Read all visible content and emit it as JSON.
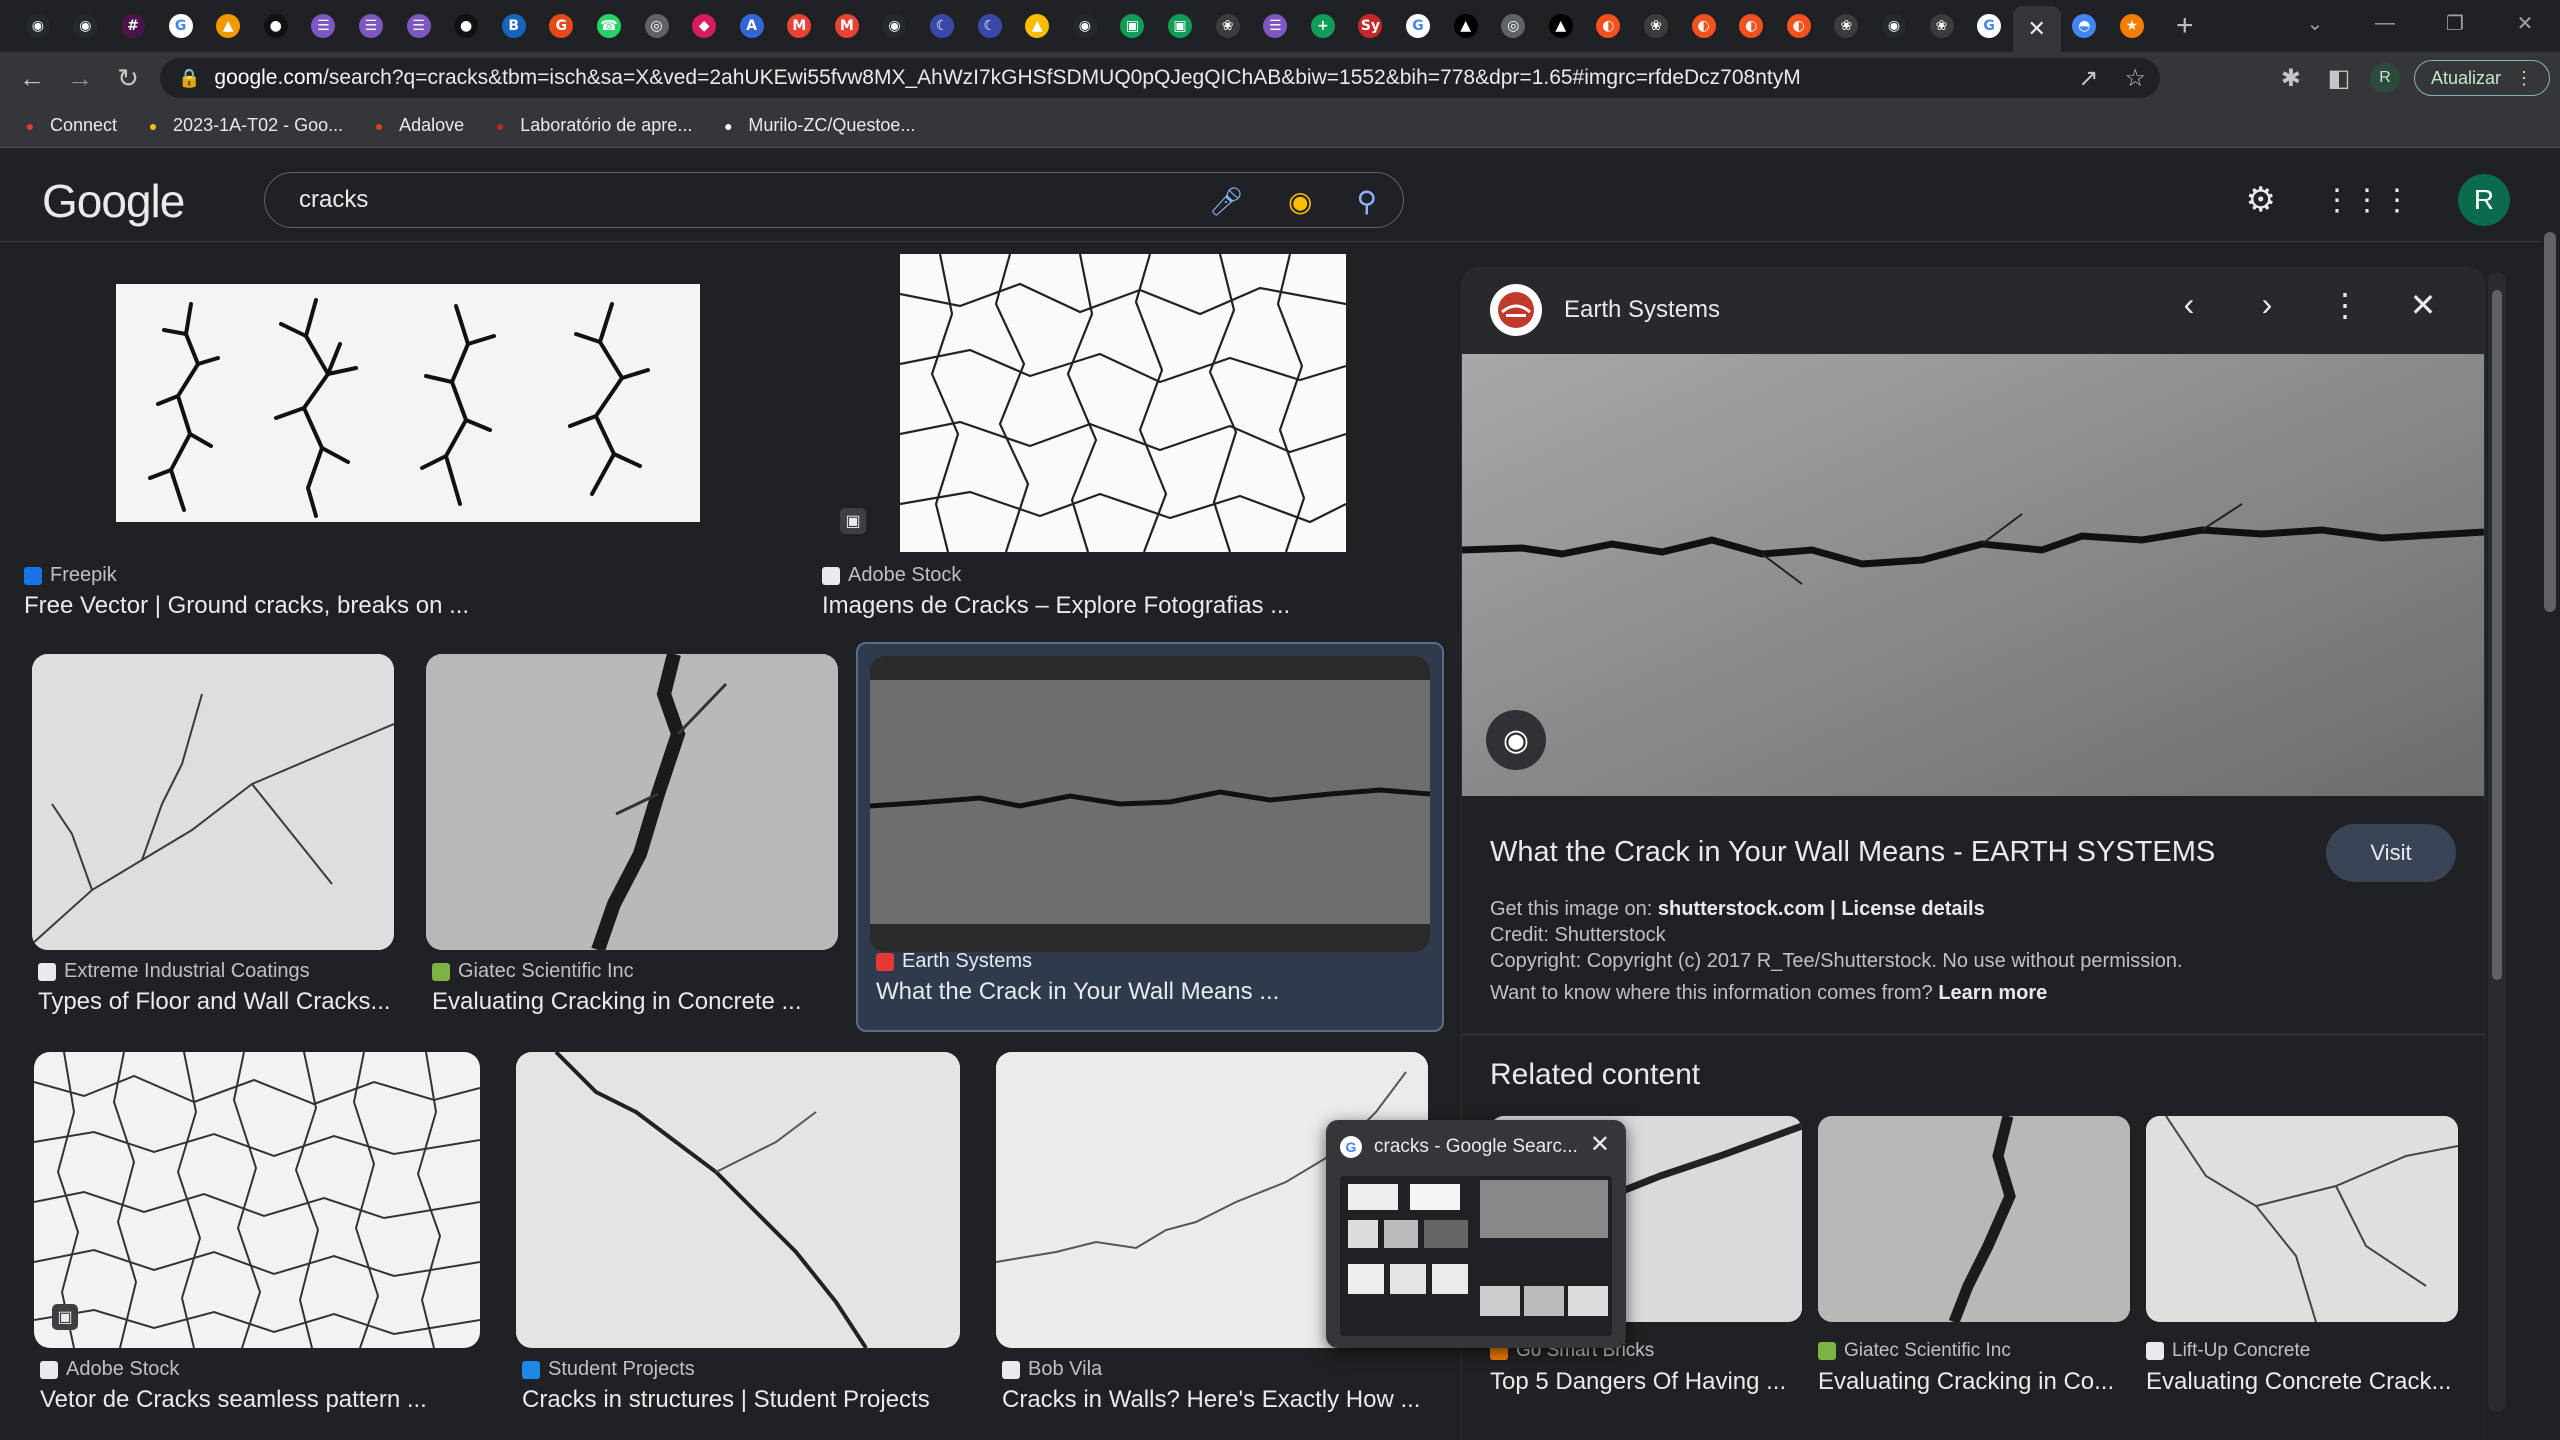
{
  "browser": {
    "tabs": [
      {
        "icon": "github-icon",
        "glyph": "◉",
        "bg": "#24292f"
      },
      {
        "icon": "github-icon",
        "glyph": "◉",
        "bg": "#24292f"
      },
      {
        "icon": "slack-icon",
        "glyph": "#",
        "bg": "#4a154b"
      },
      {
        "icon": "google-icon",
        "glyph": "G",
        "bg": "#ffffff"
      },
      {
        "icon": "orange-icon",
        "glyph": "▲",
        "bg": "#f29900"
      },
      {
        "icon": "notion-icon",
        "glyph": "●",
        "bg": "#111111"
      },
      {
        "icon": "list-icon",
        "glyph": "☰",
        "bg": "#7e57c2"
      },
      {
        "icon": "list-icon",
        "glyph": "☰",
        "bg": "#7e57c2"
      },
      {
        "icon": "list-icon",
        "glyph": "☰",
        "bg": "#7e57c2"
      },
      {
        "icon": "notion-icon",
        "glyph": "●",
        "bg": "#111111"
      },
      {
        "icon": "b-icon",
        "glyph": "B",
        "bg": "#1565c0"
      },
      {
        "icon": "g-icon",
        "glyph": "G",
        "bg": "#e64a19"
      },
      {
        "icon": "whatsapp-icon",
        "glyph": "☎",
        "bg": "#25d366"
      },
      {
        "icon": "globe-icon",
        "glyph": "◎",
        "bg": "#5f6368"
      },
      {
        "icon": "pin-icon",
        "glyph": "◆",
        "bg": "#d81b60"
      },
      {
        "icon": "a-icon",
        "glyph": "A",
        "bg": "#3367d6"
      },
      {
        "icon": "gmail-icon",
        "glyph": "M",
        "bg": "#ea4335"
      },
      {
        "icon": "gmail-icon",
        "glyph": "M",
        "bg": "#ea4335"
      },
      {
        "icon": "github-icon",
        "glyph": "◉",
        "bg": "#24292f"
      },
      {
        "icon": "moon-icon",
        "glyph": "☾",
        "bg": "#3949ab"
      },
      {
        "icon": "moon-icon",
        "glyph": "☾",
        "bg": "#3949ab"
      },
      {
        "icon": "drive-icon",
        "glyph": "▲",
        "bg": "#fbbc04"
      },
      {
        "icon": "github-icon",
        "glyph": "◉",
        "bg": "#24292f"
      },
      {
        "icon": "chart-icon",
        "glyph": "▣",
        "bg": "#0f9d58"
      },
      {
        "icon": "chart-icon",
        "glyph": "▣",
        "bg": "#0f9d58"
      },
      {
        "icon": "chatgpt-icon",
        "glyph": "❀",
        "bg": "#3c3c3c"
      },
      {
        "icon": "list-icon",
        "glyph": "☰",
        "bg": "#7e57c2"
      },
      {
        "icon": "sheets-icon",
        "glyph": "+",
        "bg": "#0f9d58"
      },
      {
        "icon": "sy-icon",
        "glyph": "Sy",
        "bg": "#c62828"
      },
      {
        "icon": "google-icon",
        "glyph": "G",
        "bg": "#ffffff"
      },
      {
        "icon": "triangle-icon",
        "glyph": "▲",
        "bg": "#000000"
      },
      {
        "icon": "globe-icon",
        "glyph": "◎",
        "bg": "#5f6368"
      },
      {
        "icon": "triangle-icon",
        "glyph": "▲",
        "bg": "#000000"
      },
      {
        "icon": "orange-app-icon",
        "glyph": "◐",
        "bg": "#f4511e"
      },
      {
        "icon": "chatgpt-icon",
        "glyph": "❀",
        "bg": "#3c3c3c"
      },
      {
        "icon": "orange-app-icon",
        "glyph": "◐",
        "bg": "#f4511e"
      },
      {
        "icon": "orange-app-icon",
        "glyph": "◐",
        "bg": "#f4511e"
      },
      {
        "icon": "orange-app-icon",
        "glyph": "◐",
        "bg": "#f4511e"
      },
      {
        "icon": "chatgpt-icon",
        "glyph": "❀",
        "bg": "#3c3c3c"
      },
      {
        "icon": "github-icon",
        "glyph": "◉",
        "bg": "#24292f"
      },
      {
        "icon": "chatgpt-icon",
        "glyph": "❀",
        "bg": "#3c3c3c"
      },
      {
        "icon": "google-icon",
        "glyph": "G",
        "bg": "#ffffff"
      },
      {
        "icon": "close-icon",
        "glyph": "✕",
        "bg": "transparent",
        "active": true
      },
      {
        "icon": "shield-icon",
        "glyph": "◓",
        "bg": "#4285f4"
      },
      {
        "icon": "bird-icon",
        "glyph": "★",
        "bg": "#f57c00"
      }
    ],
    "url_prefix": "google.com",
    "url_rest": "/search?q=cracks&tbm=isch&sa=X&ved=2ahUKEwi55fvw8MX_AhWzI7kGHSfSDMUQ0pQJegQIChAB&biw=1552&bih=778&dpr=1.65#imgrc=rfdeDcz708ntyM",
    "profile_initial": "R",
    "update_label": "Atualizar",
    "bookmarks": [
      {
        "label": "Connect",
        "icon": "connect-icon",
        "color": "#e53935"
      },
      {
        "label": "2023-1A-T02 - Goo...",
        "icon": "drive-icon",
        "color": "#fbbc04"
      },
      {
        "label": "Adalove",
        "icon": "adalove-icon",
        "color": "#d84315"
      },
      {
        "label": "Laboratório de apre...",
        "icon": "lab-icon",
        "color": "#c62828"
      },
      {
        "label": "Murilo-ZC/Questoe...",
        "icon": "github-icon",
        "color": "#ffffff"
      }
    ],
    "preview": {
      "title": "cracks - Google Searc..."
    }
  },
  "google": {
    "logo": "Google",
    "query": "cracks",
    "avatar": "R"
  },
  "results": [
    {
      "source": "Freepik",
      "title": "Free Vector | Ground cracks, breaks on ...",
      "srcColor": "#1a73e8"
    },
    {
      "source": "Adobe Stock",
      "title": "Imagens de Cracks – Explore Fotografias ...",
      "srcColor": "#e8eaed"
    },
    {
      "source": "Extreme Industrial Coatings",
      "title": "Types of Floor and Wall Cracks...",
      "srcColor": "#e8eaed"
    },
    {
      "source": "Giatec Scientific Inc",
      "title": "Evaluating Cracking in Concrete ...",
      "srcColor": "#7cb342"
    },
    {
      "source": "Earth Systems",
      "title": "What the Crack in Your Wall Means ...",
      "srcColor": "#e53935"
    },
    {
      "source": "Adobe Stock",
      "title": "Vetor de Cracks seamless pattern ...",
      "srcColor": "#e8eaed"
    },
    {
      "source": "Student Projects",
      "title": "Cracks in structures | Student Projects",
      "srcColor": "#1e88e5"
    },
    {
      "source": "Bob Vila",
      "title": "Cracks in Walls? Here's Exactly How ...",
      "srcColor": "#e8eaed"
    }
  ],
  "panel": {
    "source": "Earth Systems",
    "title": "What the Crack in Your Wall Means - EARTH SYSTEMS",
    "visit": "Visit",
    "get_prefix": "Get this image on:",
    "get_site": "shutterstock.com",
    "sep": "|",
    "license": "License details",
    "credit": "Credit: Shutterstock",
    "copyright": "Copyright: Copyright (c) 2017 R_Tee/Shutterstock. No use without permission.",
    "want": "Want to know where this information comes from?",
    "learn": "Learn more",
    "related_heading": "Related content",
    "related": [
      {
        "source": "Go Smart Bricks",
        "title": "Top 5 Dangers Of Having ...",
        "srcColor": "#f57c00"
      },
      {
        "source": "Giatec Scientific Inc",
        "title": "Evaluating Cracking in Co...",
        "srcColor": "#7cb342"
      },
      {
        "source": "Lift-Up Concrete",
        "title": "Evaluating Concrete Crack...",
        "srcColor": "#e8eaed"
      }
    ]
  }
}
